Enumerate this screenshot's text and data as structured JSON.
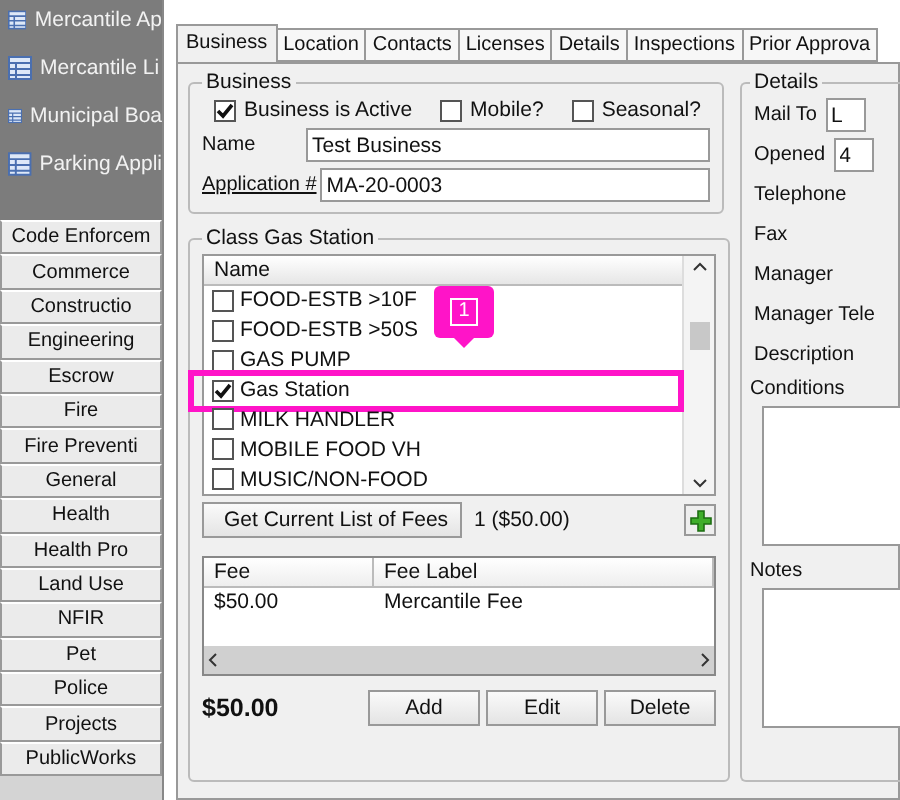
{
  "sidebar": {
    "modules": [
      {
        "label": "Mercantile Ap"
      },
      {
        "label": "Mercantile Li"
      },
      {
        "label": "Municipal Boa"
      },
      {
        "label": "Parking Appli"
      }
    ],
    "categories": [
      "Code Enforcem",
      "Commerce",
      "Constructio",
      "Engineering",
      "Escrow",
      "Fire",
      "Fire Preventi",
      "General",
      "Health",
      "Health Pro",
      "Land Use",
      "NFIR",
      "Pet",
      "Police",
      "Projects",
      "PublicWorks"
    ]
  },
  "tabs": [
    {
      "label": "Business",
      "selected": true
    },
    {
      "label": "Location",
      "selected": false
    },
    {
      "label": "Contacts",
      "selected": false
    },
    {
      "label": "Licenses",
      "selected": false
    },
    {
      "label": "Details",
      "selected": false
    },
    {
      "label": "Inspections",
      "selected": false
    },
    {
      "label": "Prior Approva",
      "selected": false
    }
  ],
  "business": {
    "title": "Business",
    "checkboxes": [
      {
        "label": "Business is Active",
        "checked": true
      },
      {
        "label": "Mobile?",
        "checked": false
      },
      {
        "label": "Seasonal?",
        "checked": false
      }
    ],
    "fields": [
      {
        "label": "Name",
        "value": "Test Business",
        "underlined": false
      },
      {
        "label": "Application #",
        "value": "MA-20-0003",
        "underlined": true
      }
    ]
  },
  "class_group": {
    "title": "Class Gas Station",
    "list_header": "Name",
    "items": [
      {
        "label": "FOOD-ESTB >10F",
        "checked": false,
        "highlighted": false
      },
      {
        "label": "FOOD-ESTB >50S",
        "checked": false,
        "highlighted": false
      },
      {
        "label": "GAS PUMP",
        "checked": false,
        "highlighted": false
      },
      {
        "label": "Gas Station",
        "checked": true,
        "highlighted": true
      },
      {
        "label": "MILK HANDLER",
        "checked": false,
        "highlighted": false
      },
      {
        "label": "MOBILE FOOD VH",
        "checked": false,
        "highlighted": false
      },
      {
        "label": "MUSIC/NON-FOOD",
        "checked": false,
        "highlighted": false
      }
    ],
    "callout": "1",
    "fees_button": "Get Current List of Fees",
    "fees_count": "1 ($50.00)",
    "fee_table": {
      "columns": [
        "Fee",
        "Fee Label"
      ],
      "rows": [
        [
          "$50.00",
          "Mercantile Fee"
        ]
      ]
    },
    "total": "$50.00",
    "buttons": [
      "Add",
      "Edit",
      "Delete"
    ]
  },
  "details": {
    "title": "Details",
    "fields": [
      {
        "label": "Mail To",
        "value": "L",
        "kind": "input"
      },
      {
        "label": "Opened",
        "value": "4",
        "kind": "input"
      },
      {
        "label": "Telephone",
        "kind": "text"
      },
      {
        "label": "Fax",
        "kind": "text"
      },
      {
        "label": "Manager",
        "kind": "text"
      },
      {
        "label": "Manager Tele",
        "kind": "text"
      },
      {
        "label": "Description",
        "kind": "text"
      },
      {
        "label": "Conditions",
        "kind": "area"
      },
      {
        "label": "Notes",
        "kind": "area"
      }
    ]
  }
}
